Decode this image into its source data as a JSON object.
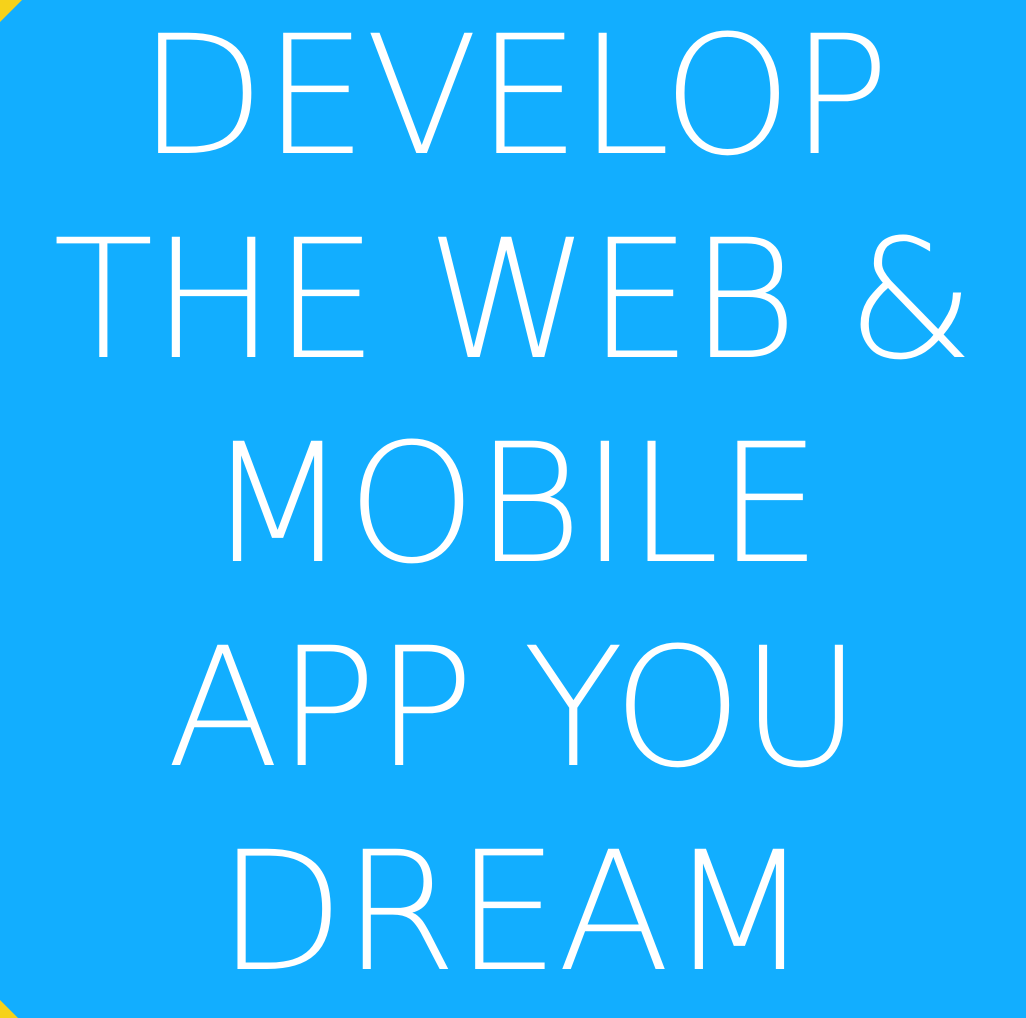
{
  "colors": {
    "background": "#12AEFF",
    "text": "#FFFFFF",
    "corner_accent": "#F6D21A"
  },
  "headline": {
    "lines": [
      "DEVELOP",
      "THE WEB &",
      "MOBILE",
      "APP YOU",
      "DREAM"
    ]
  }
}
